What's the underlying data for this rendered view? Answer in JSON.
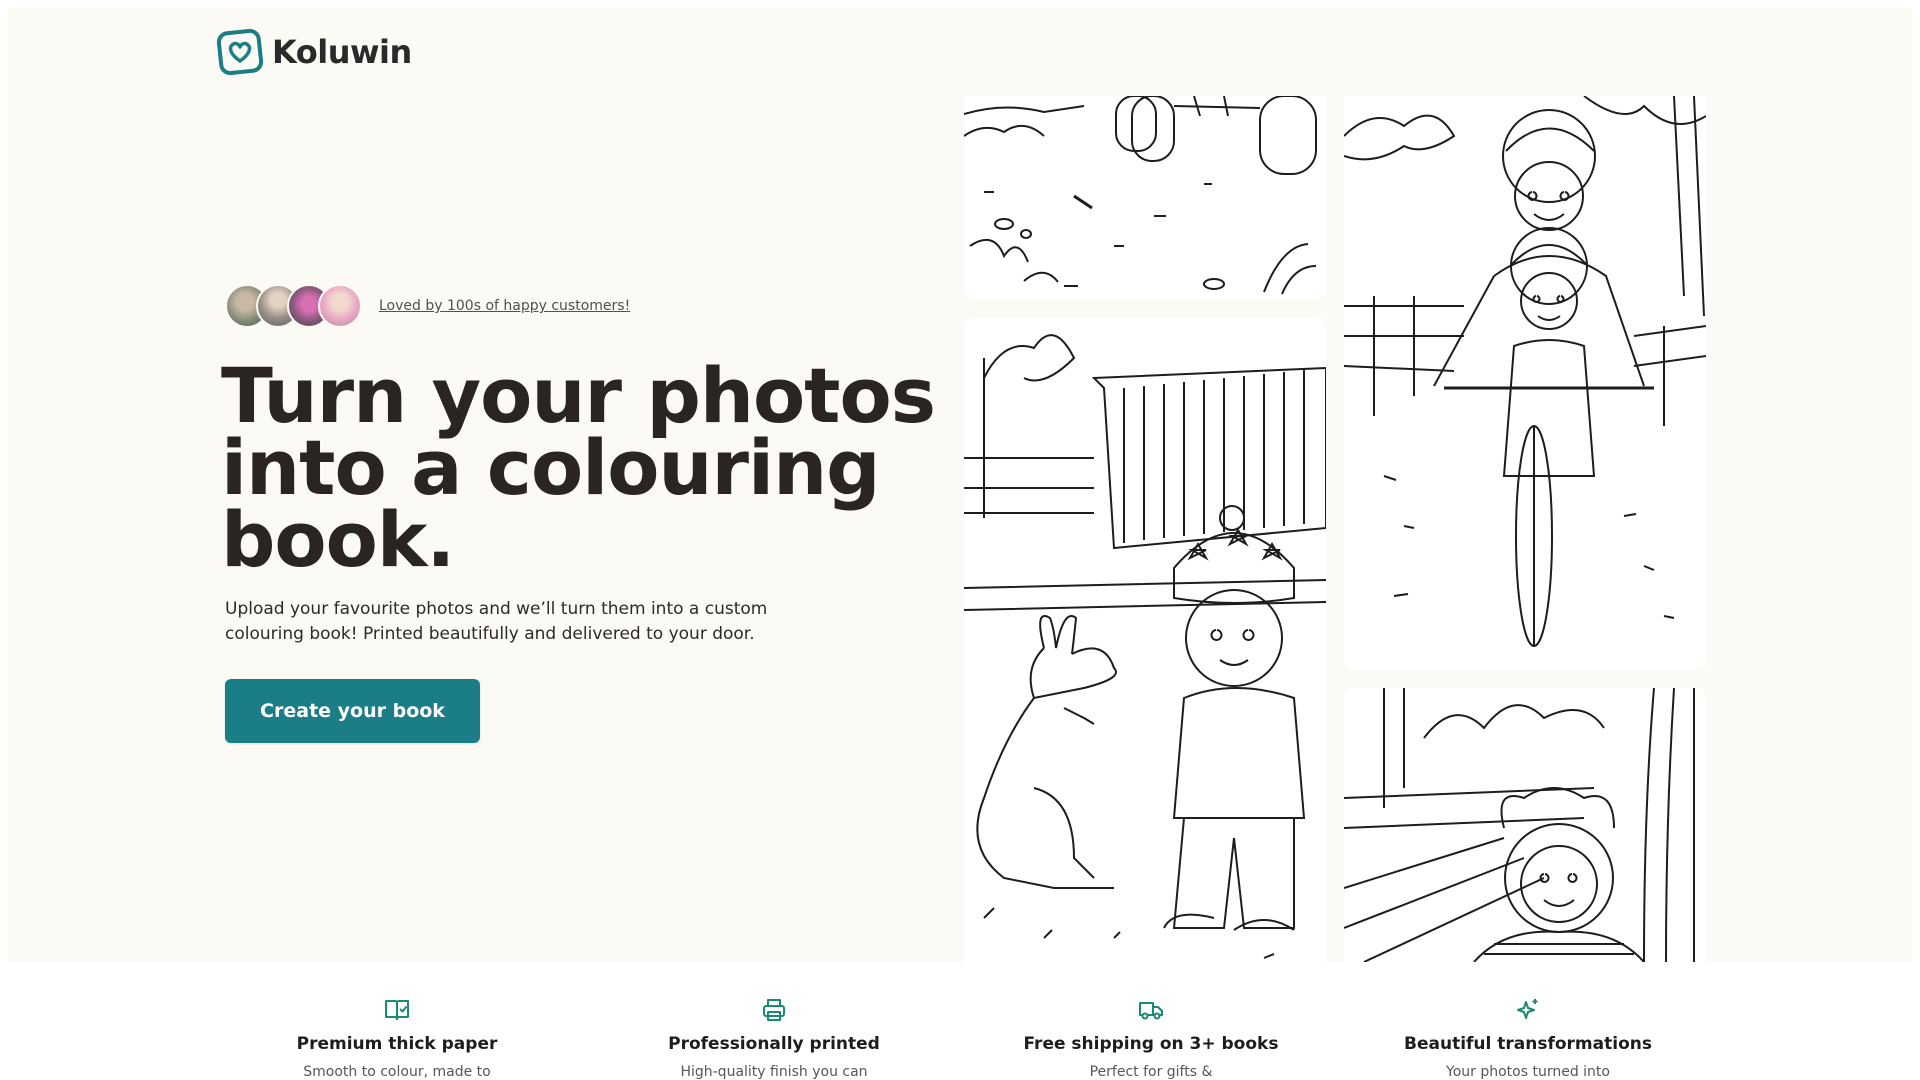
{
  "brand": {
    "name": "Koluwin",
    "logo_icon": "heart-badge-icon"
  },
  "social_proof": {
    "text": "Loved by 100s of happy customers!",
    "avatars": [
      "customer-1",
      "customer-2",
      "customer-3",
      "customer-4"
    ]
  },
  "hero": {
    "headline_lines": [
      "Turn your photos",
      "into a colouring",
      "book."
    ],
    "subtitle": "Upload your favourite photos and we’ll turn them into a custom colouring book! Printed beautifully and delivered to your door.",
    "cta_label": "Create your book",
    "accent_color": "#1b7e86",
    "background_color": "#fbfaf5"
  },
  "gallery": [
    {
      "subject": "farm-scene-with-tractor-wheels"
    },
    {
      "subject": "parent-and-child-cycling"
    },
    {
      "subject": "child-with-kangaroo"
    },
    {
      "subject": "child-in-bear-hood"
    }
  ],
  "features": [
    {
      "icon": "book-check-icon",
      "title": "Premium thick paper",
      "desc": "Smooth to colour, made to"
    },
    {
      "icon": "printer-icon",
      "title": "Professionally printed",
      "desc": "High-quality finish you can"
    },
    {
      "icon": "truck-icon",
      "title": "Free shipping on 3+ books",
      "desc": "Perfect for gifts &"
    },
    {
      "icon": "sparkles-icon",
      "title": "Beautiful transformations",
      "desc": "Your photos turned into"
    }
  ]
}
